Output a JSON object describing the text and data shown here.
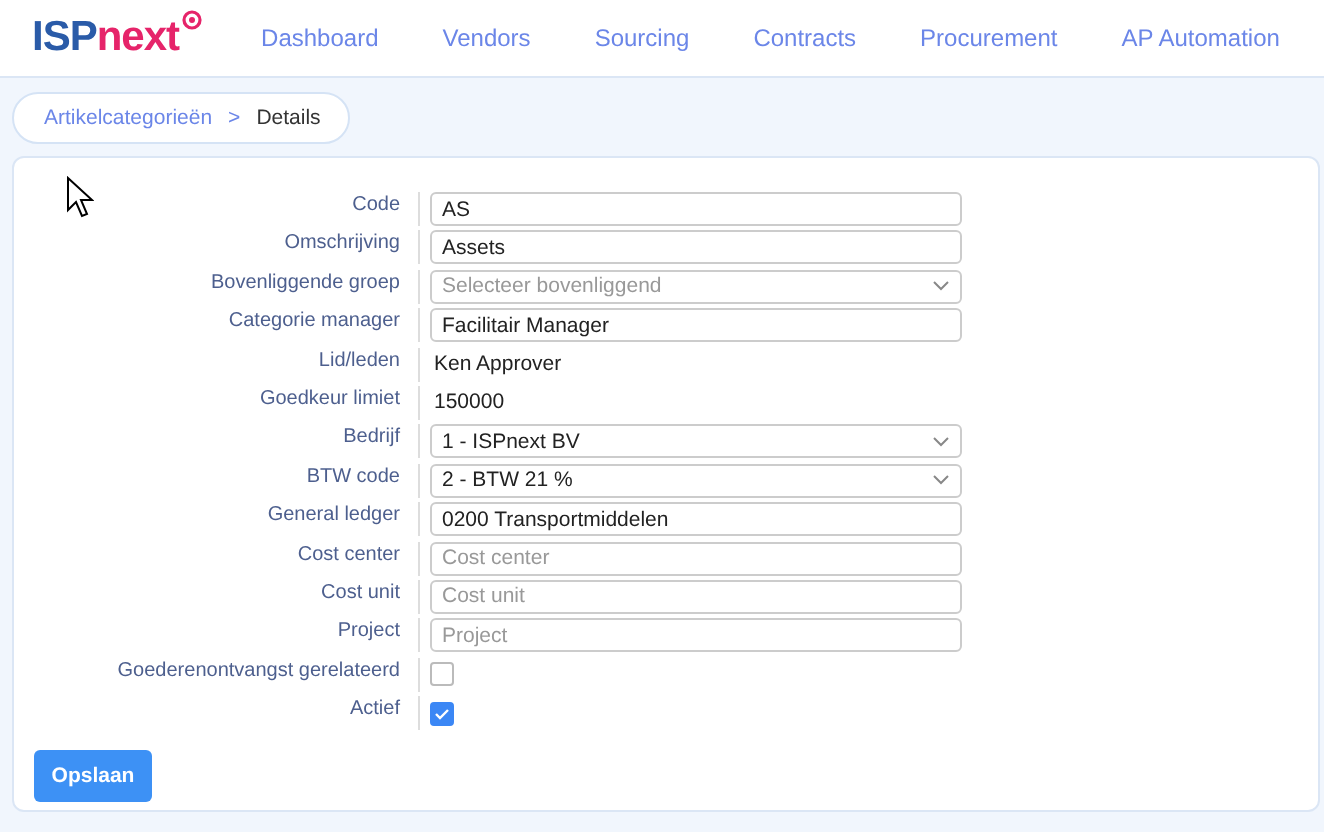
{
  "header": {
    "logo": {
      "part1": "ISP",
      "part2": "next"
    },
    "nav": [
      {
        "label": "Dashboard"
      },
      {
        "label": "Vendors"
      },
      {
        "label": "Sourcing"
      },
      {
        "label": "Contracts"
      },
      {
        "label": "Procurement"
      },
      {
        "label": "AP Automation"
      }
    ]
  },
  "breadcrumb": [
    {
      "label": "Artikelcategorieën",
      "kind": "link"
    },
    {
      "label": ">",
      "kind": "separator"
    },
    {
      "label": "Details",
      "kind": "current"
    }
  ],
  "form": {
    "rows": [
      {
        "label": "Code",
        "kind": "input",
        "value": "AS"
      },
      {
        "label": "Omschrijving",
        "kind": "input",
        "value": "Assets"
      },
      {
        "label": "Bovenliggende groep",
        "kind": "select",
        "placeholder": "Selecteer bovenliggend"
      },
      {
        "label": "Categorie manager",
        "kind": "input",
        "value": "Facilitair Manager"
      },
      {
        "label": "Lid/leden",
        "kind": "text",
        "value": "Ken Approver"
      },
      {
        "label": "Goedkeur limiet",
        "kind": "text",
        "value": "150000"
      },
      {
        "label": "Bedrijf",
        "kind": "select",
        "value": "1 - ISPnext BV"
      },
      {
        "label": "BTW code",
        "kind": "select",
        "value": "2 - BTW 21 %"
      },
      {
        "label": "General ledger",
        "kind": "input",
        "value": "0200 Transportmiddelen"
      },
      {
        "label": "Cost center",
        "kind": "input",
        "placeholder": "Cost center"
      },
      {
        "label": "Cost unit",
        "kind": "input",
        "placeholder": "Cost unit"
      },
      {
        "label": "Project",
        "kind": "input",
        "placeholder": "Project"
      },
      {
        "label": "Goederenontvangst gerelateerd",
        "kind": "checkbox",
        "checked": false
      },
      {
        "label": "Actief",
        "kind": "checkbox",
        "checked": true
      }
    ],
    "save_button": "Opslaan"
  }
}
